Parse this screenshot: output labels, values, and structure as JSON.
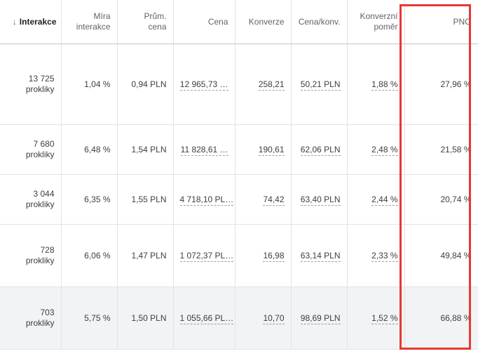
{
  "header": {
    "sort_arrow": "↓",
    "interactions": "Interakce",
    "interaction_rate": "Míra interakce",
    "avg_price": "Prům. cena",
    "cost": "Cena",
    "conversions": "Konverze",
    "cost_per_conv": "Cena/konv.",
    "conv_rate": "Konverzní poměr",
    "pno": "PNO"
  },
  "rows": [
    {
      "interactions": "13 725",
      "unit": "prokliky",
      "rate": "1,04 %",
      "avg": "0,94 PLN",
      "cost": "12 965,73 …",
      "conv": "258,21",
      "cpc": "50,21 PLN",
      "cr": "1,88 %",
      "pno": "27,96 %"
    },
    {
      "interactions": "7 680",
      "unit": "prokliky",
      "rate": "6,48 %",
      "avg": "1,54 PLN",
      "cost": "11 828,61 …",
      "conv": "190,61",
      "cpc": "62,06 PLN",
      "cr": "2,48 %",
      "pno": "21,58 %"
    },
    {
      "interactions": "3 044",
      "unit": "prokliky",
      "rate": "6,35 %",
      "avg": "1,55 PLN",
      "cost": "4 718,10 PL…",
      "conv": "74,42",
      "cpc": "63,40 PLN",
      "cr": "2,44 %",
      "pno": "20,74 %"
    },
    {
      "interactions": "728",
      "unit": "prokliky",
      "rate": "6,06 %",
      "avg": "1,47 PLN",
      "cost": "1 072,37 PL…",
      "conv": "16,98",
      "cpc": "63,14 PLN",
      "cr": "2,33 %",
      "pno": "49,84 %"
    },
    {
      "interactions": "703",
      "unit": "prokliky",
      "rate": "5,75 %",
      "avg": "1,50 PLN",
      "cost": "1 055,66 PL…",
      "conv": "10,70",
      "cpc": "98,69 PLN",
      "cr": "1,52 %",
      "pno": "66,88 %"
    }
  ],
  "highlight_color": "#e53935"
}
